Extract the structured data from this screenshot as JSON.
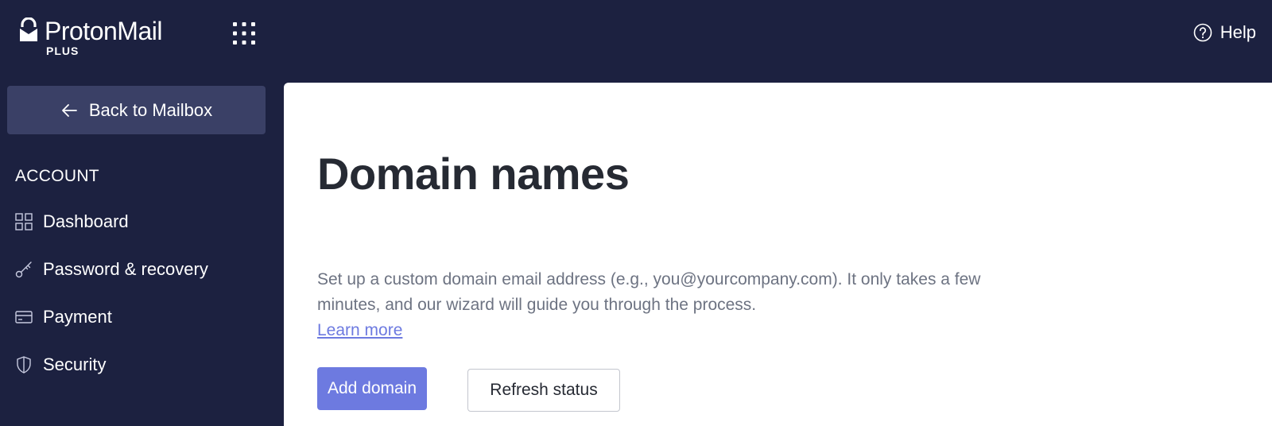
{
  "colors": {
    "background": "#1c2140",
    "sidebar_button": "#3a4066",
    "accent": "#6d7ae0",
    "content_bg": "#ffffff",
    "title_text": "#262a33",
    "muted_text": "#6d7382"
  },
  "header": {
    "brand_name": "ProtonMail",
    "brand_plan": "PLUS",
    "logo_icon": "protonmail-lock-icon",
    "apps_icon": "grid-icon",
    "help": {
      "icon": "question-circle-icon",
      "label": "Help"
    }
  },
  "sidebar": {
    "back_button": {
      "icon": "arrow-left-icon",
      "label": "Back to Mailbox"
    },
    "section_title": "ACCOUNT",
    "items": [
      {
        "icon": "dashboard-grid-icon",
        "label": "Dashboard"
      },
      {
        "icon": "key-icon",
        "label": "Password & recovery"
      },
      {
        "icon": "credit-card-icon",
        "label": "Payment"
      },
      {
        "icon": "shield-icon",
        "label": "Security"
      }
    ]
  },
  "main": {
    "title": "Domain names",
    "description": "Set up a custom domain email address (e.g., you@yourcompany.com). It only takes a few minutes, and our wizard will guide you through the process.",
    "learn_more": "Learn more",
    "add_domain_label": "Add domain",
    "refresh_status_label": "Refresh status"
  }
}
